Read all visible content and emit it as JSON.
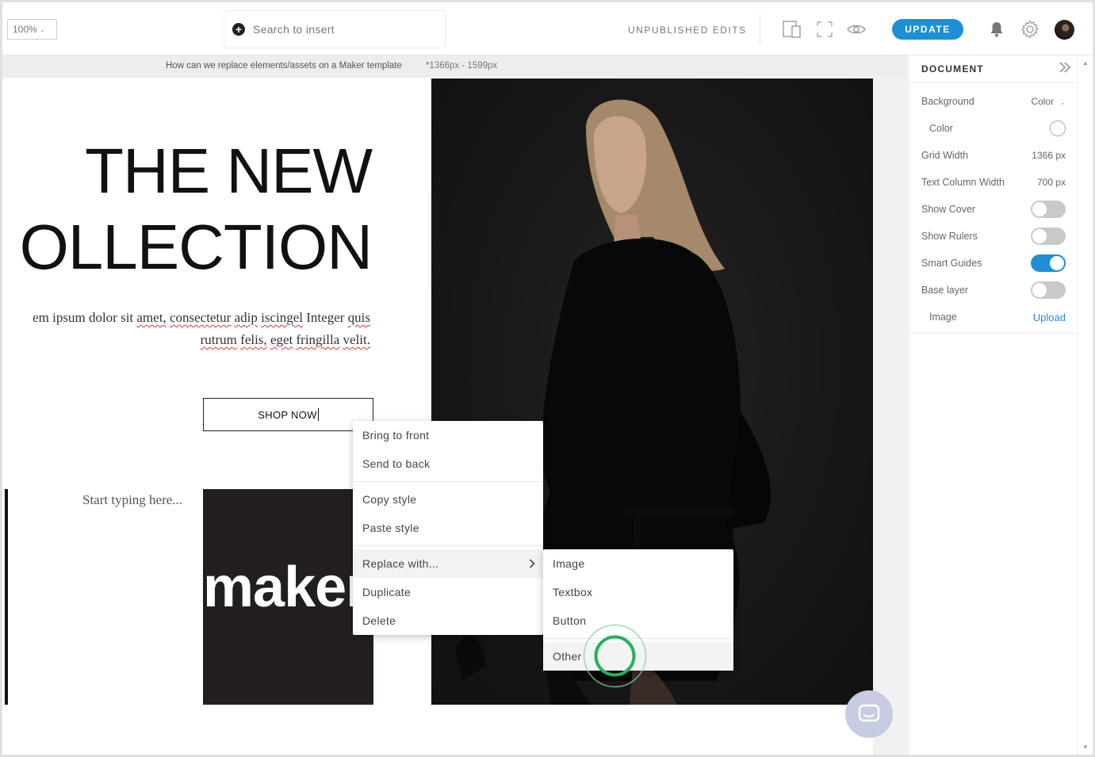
{
  "topbar": {
    "zoom": "100%",
    "search_placeholder": "Search to insert",
    "status": "UNPUBLISHED EDITS",
    "update_label": "UPDATE",
    "icons": [
      "responsive-icon",
      "fullscreen-icon",
      "preview-eye-icon",
      "bell-icon",
      "gear-icon"
    ]
  },
  "breadcrumb": {
    "page_name": "How can we replace elements/assets on a Maker template",
    "dimensions": "*1366px - 1599px"
  },
  "canvas": {
    "headline_line1": "THE NEW",
    "headline_line2": "OLLECTION",
    "body_pre": "em ipsum dolor sit",
    "body_words": [
      "amet,",
      "consectetur",
      "adip",
      "iscingel"
    ],
    "body_mid": "Integer",
    "body_word_quis": "quis",
    "body_line2": [
      "rutrum",
      "felis,",
      "eget",
      "fringilla",
      "velit."
    ],
    "button_text": "SHOP NOW",
    "placeholder_text": "Start typing here...",
    "logo_text": "maker"
  },
  "context_menu": {
    "items": [
      "Bring to front",
      "Send to back",
      "Copy style",
      "Paste style",
      "Replace with...",
      "Duplicate",
      "Delete"
    ]
  },
  "submenu": {
    "items": [
      "Image",
      "Textbox",
      "Button",
      "Other"
    ]
  },
  "panel": {
    "title": "DOCUMENT",
    "background_label": "Background",
    "background_value": "Color",
    "color_label": "Color",
    "grid_width_label": "Grid Width",
    "grid_width_value": "1366 px",
    "text_col_label": "Text Column Width",
    "text_col_value": "700 px",
    "show_cover_label": "Show Cover",
    "show_cover": false,
    "show_rulers_label": "Show Rulers",
    "show_rulers": false,
    "smart_guides_label": "Smart Guides",
    "smart_guides": true,
    "base_layer_label": "Base layer",
    "base_layer": false,
    "image_label": "Image",
    "image_action": "Upload"
  },
  "colors": {
    "accent": "#1d8fd6",
    "ripple": "#22b35a"
  }
}
